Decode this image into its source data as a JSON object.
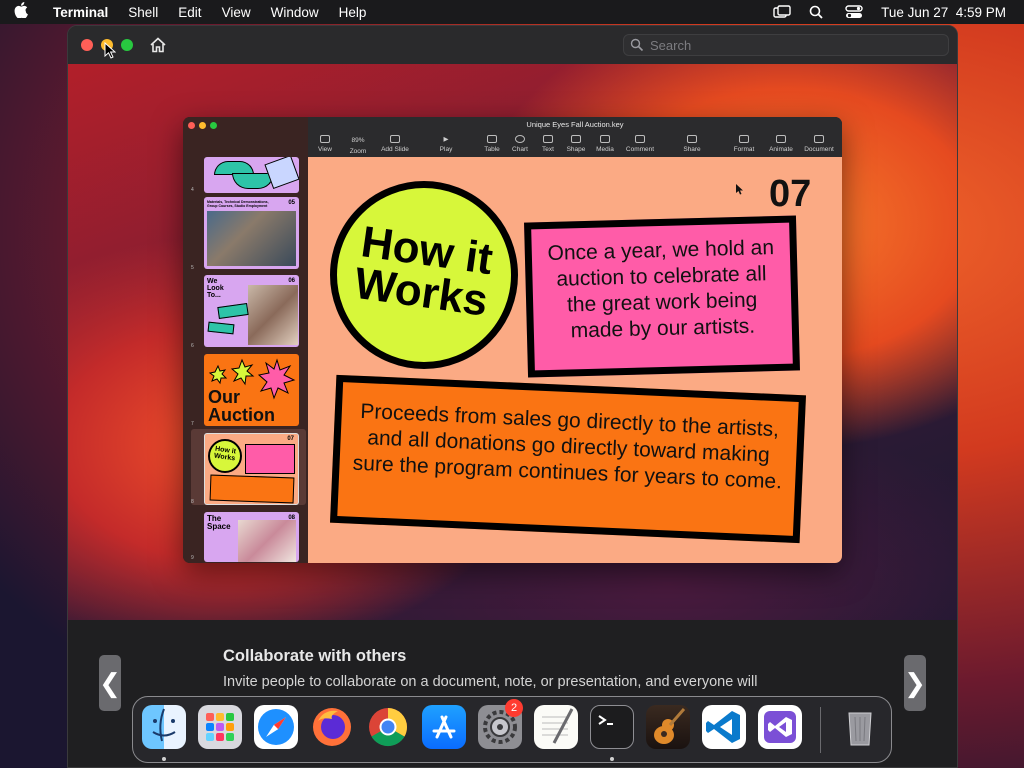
{
  "menubar": {
    "app_name": "Terminal",
    "items": [
      "Shell",
      "Edit",
      "View",
      "Window",
      "Help"
    ],
    "datetime": "Tue Jun 27  4:59 PM",
    "icons": [
      "apple-icon",
      "screen-mirroring-icon",
      "spotlight-search-icon",
      "control-center-icon"
    ]
  },
  "window": {
    "search_placeholder": "Search"
  },
  "keynote": {
    "title": "Unique Eyes Fall Auction.key",
    "zoom": "89%",
    "toolbar": [
      "View",
      "Zoom",
      "Add Slide",
      "Play",
      "Table",
      "Chart",
      "Text",
      "Shape",
      "Media",
      "Comment",
      "Share",
      "Format",
      "Animate",
      "Document"
    ],
    "thumbnails": [
      {
        "num": "4",
        "title": "",
        "badge": ""
      },
      {
        "num": "5",
        "title": "Materials, Technical Demonstrations, Group Courses, Studio Employment",
        "badge": "05"
      },
      {
        "num": "6",
        "title": "We Look To...",
        "badge": "06"
      },
      {
        "num": "7",
        "title": "Our Auction",
        "badge": ""
      },
      {
        "num": "8",
        "title": "How it Works",
        "badge": "07"
      },
      {
        "num": "9",
        "title": "The Space",
        "badge": "08"
      }
    ],
    "slide": {
      "number": "07",
      "headline": "How it Works",
      "pink_text": "Once a year, we hold an auction to celebrate all the great work being made by our artists.",
      "orange_text": "Proceeds from sales go directly to the artists, and all donations go directly toward making sure the program continues for years to come."
    }
  },
  "info": {
    "title": "Collaborate with others",
    "body": "Invite people to collaborate on a document, note, or presentation, and everyone will",
    "prev": "❮",
    "next": "❯"
  },
  "dock": {
    "apps": [
      "Finder",
      "Launchpad",
      "Safari",
      "Firefox",
      "Chrome",
      "App Store",
      "System Settings",
      "TextEdit",
      "Terminal",
      "GarageBand",
      "Visual Studio Code",
      "Visual Studio",
      "Trash"
    ],
    "settings_badge": "2"
  },
  "colors": {
    "slide_bg": "#fbaa84",
    "circle": "#d7f73a",
    "pink": "#ff5ca8",
    "orange": "#fa7413"
  }
}
